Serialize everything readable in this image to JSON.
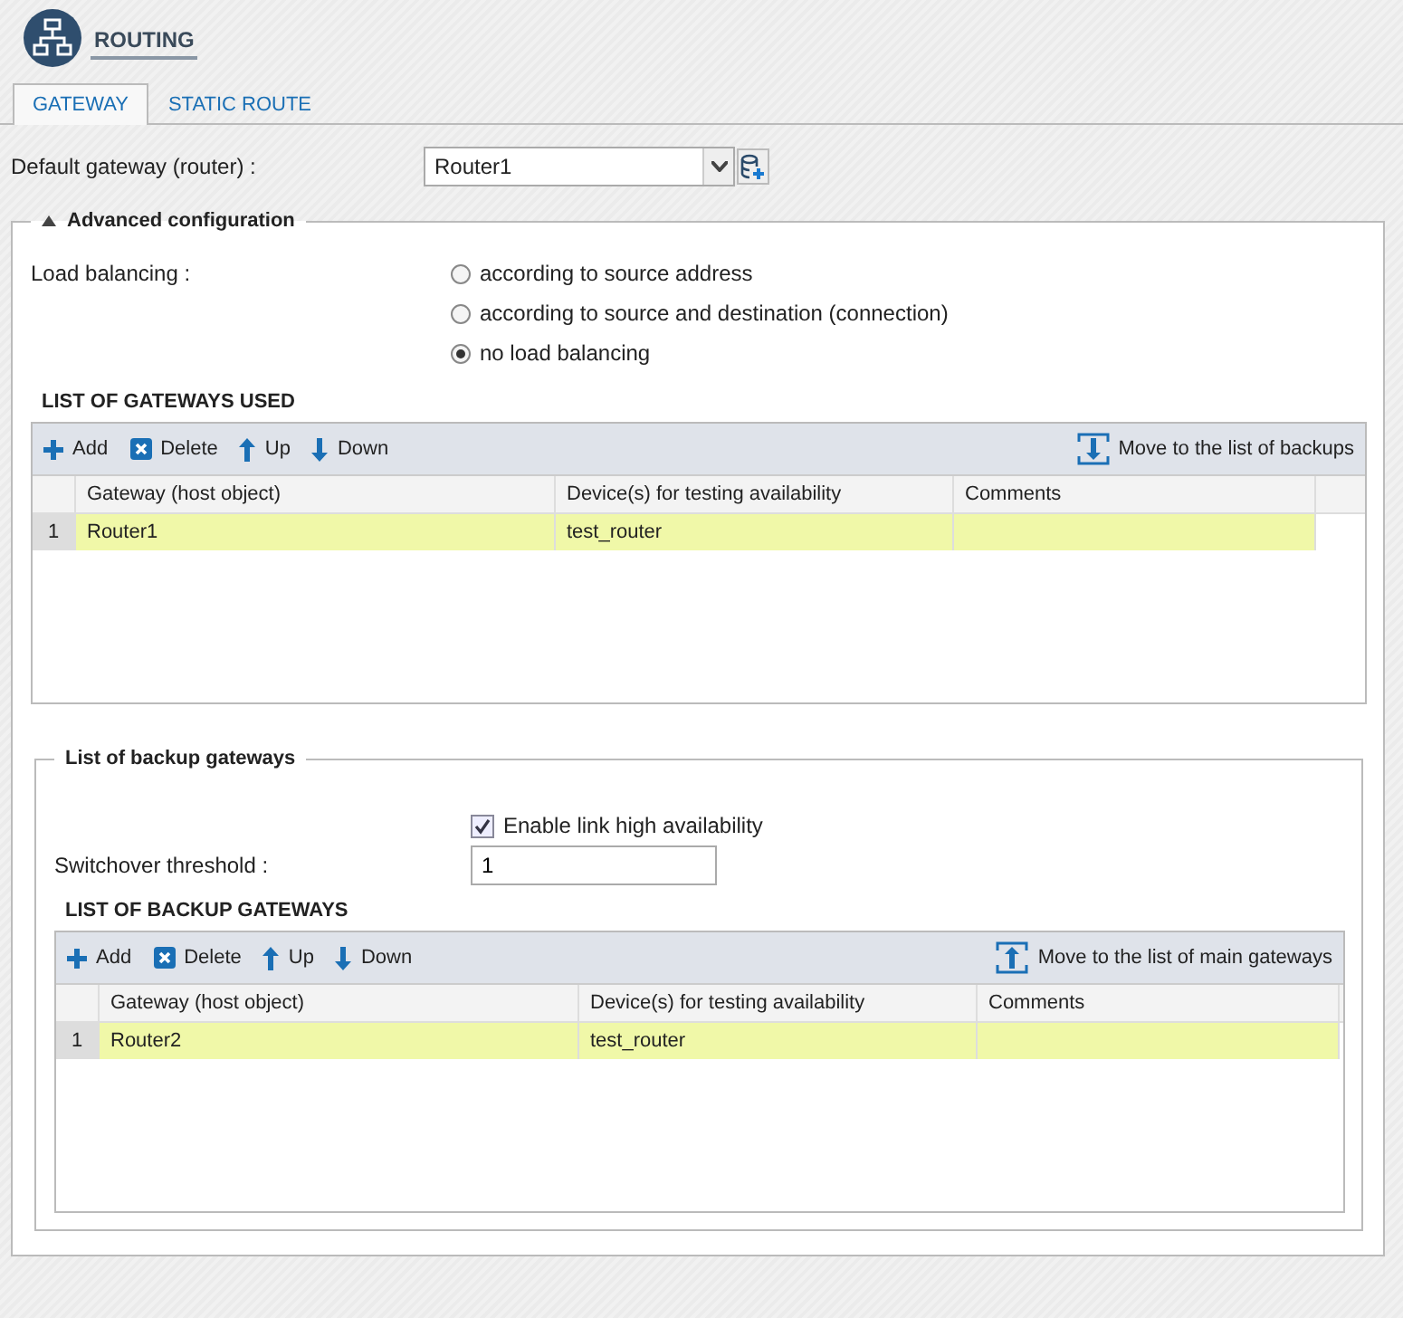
{
  "header": {
    "title": "ROUTING"
  },
  "tabs": [
    {
      "label": "GATEWAY",
      "selected": true
    },
    {
      "label": "STATIC ROUTE",
      "selected": false
    }
  ],
  "default_gateway": {
    "label": "Default gateway (router) :",
    "value": "Router1"
  },
  "advanced": {
    "title": "Advanced configuration",
    "expanded": true,
    "load_balancing": {
      "label": "Load balancing :",
      "options": [
        {
          "label": "according to source address",
          "selected": false
        },
        {
          "label": "according to source and destination (connection)",
          "selected": false
        },
        {
          "label": "no load balancing",
          "selected": true
        }
      ]
    },
    "gateways": {
      "title": "LIST OF GATEWAYS USED",
      "toolbar": [
        {
          "kind": "add",
          "label": "Add"
        },
        {
          "kind": "delete",
          "label": "Delete"
        },
        {
          "kind": "up",
          "label": "Up"
        },
        {
          "kind": "down",
          "label": "Down"
        }
      ],
      "move": {
        "kind": "down",
        "label": "Move to the list of backups"
      },
      "columns": [
        "Gateway (host object)",
        "Device(s) for testing availability",
        "Comments"
      ],
      "rows": [
        {
          "number": "1",
          "gateway": "Router1",
          "devices": "test_router",
          "selected": true
        }
      ]
    },
    "backup": {
      "title": "List of backup gateways",
      "high_availability": {
        "label": "Enable link high availability",
        "checked": true
      },
      "threshold": {
        "label": "Switchover threshold :",
        "value": "1"
      },
      "gateways": {
        "title": "LIST OF BACKUP GATEWAYS",
        "toolbar": [
          {
            "kind": "add",
            "label": "Add"
          },
          {
            "kind": "delete",
            "label": "Delete"
          },
          {
            "kind": "up",
            "label": "Up"
          },
          {
            "kind": "down",
            "label": "Down"
          }
        ],
        "move": {
          "kind": "up",
          "label": "Move to the list of main gateways"
        },
        "columns": [
          "Gateway (host object)",
          "Device(s) for testing availability",
          "Comments"
        ],
        "rows": [
          {
            "number": "1",
            "gateway": "Router2",
            "devices": "test_router",
            "selected": true
          }
        ]
      }
    }
  }
}
